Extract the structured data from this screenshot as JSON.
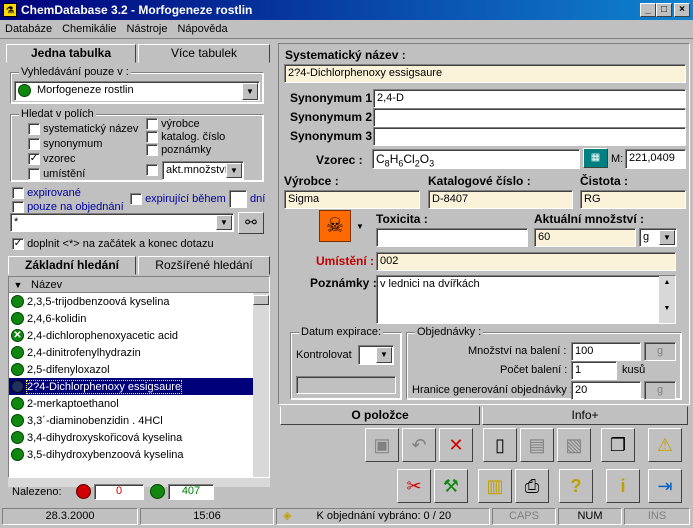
{
  "window": {
    "title": "ChemDatabase 3.2 - Morfogeneze rostlin",
    "btn_min": "_",
    "btn_max": "□",
    "btn_close": "×"
  },
  "menu": [
    "Databáze",
    "Chemikálie",
    "Nástroje",
    "Nápověda"
  ],
  "left": {
    "tabs": [
      "Jedna tabulka",
      "Více tabulek"
    ],
    "search_only_label": "Vyhledávání pouze v :",
    "search_only_value": "Morfogeneze rostlin",
    "fields_group": "Hledat v polích",
    "fields": [
      {
        "label": "systematický název",
        "checked": false
      },
      {
        "label": "synonymum",
        "checked": false
      },
      {
        "label": "vzorec",
        "checked": true
      },
      {
        "label": "umístění",
        "checked": false
      }
    ],
    "fields2": [
      {
        "label": "výrobce",
        "checked": false
      },
      {
        "label": "katalog. číslo",
        "checked": false
      },
      {
        "label": "poznámky",
        "checked": false
      }
    ],
    "quantity_combo": "akt.množství",
    "expired_label": "expirované",
    "order_only_label": "pouze na objednání",
    "expiring_label": "expirující během",
    "days_label": "dní",
    "search_value": "*",
    "wildcard_label": "doplnit <*> na začátek a konec dotazu",
    "search_tabs": [
      "Základní hledání",
      "Rozšířené hledání"
    ],
    "list_header": "Název",
    "items": [
      {
        "name": "2,3,5-trijodbenzoová kyselina",
        "mark": ""
      },
      {
        "name": "2,4,6-kolidin",
        "mark": ""
      },
      {
        "name": "2,4-dichlorophenoxyacetic acid",
        "mark": "x"
      },
      {
        "name": "2,4-dinitrofenylhydrazin",
        "mark": ""
      },
      {
        "name": "2,5-difenyloxazol",
        "mark": ""
      },
      {
        "name": "2?4-Dichlorphenoxy essigsaure",
        "mark": "sel"
      },
      {
        "name": "2-merkaptoethanol",
        "mark": ""
      },
      {
        "name": "3,3´-diaminobenzidin . 4HCl",
        "mark": ""
      },
      {
        "name": "3,4-dihydroxyskořicová kyselina",
        "mark": ""
      },
      {
        "name": "3,5-dihydroxybenzoová kyselina",
        "mark": ""
      }
    ],
    "found_label": "Nalezeno:",
    "found_red": "0",
    "found_green": "407"
  },
  "right": {
    "sys_name_label": "Systematický název :",
    "sys_name_value": "2?4-Dichlorphenoxy essigsaure",
    "syn1_label": "Synonymum 1:",
    "syn1_value": "2,4-D",
    "syn2_label": "Synonymum 2:",
    "syn2_value": "",
    "syn3_label": "Synonymum 3:",
    "syn3_value": "",
    "formula_label": "Vzorec :",
    "formula_value": "C8H6Cl2O3",
    "mw_label": "M:",
    "mw_value": "221,0409",
    "maker_label": "Výrobce :",
    "maker_value": "Sigma",
    "catalog_label": "Katalogové číslo :",
    "catalog_value": "D-8407",
    "purity_label": "Čistota :",
    "purity_value": "RG",
    "toxicity_label": "Toxicita :",
    "toxicity_value": "",
    "amount_label": "Aktuální množství :",
    "amount_value": "60",
    "amount_unit": "g",
    "location_label": "Umístění :",
    "location_value": "002",
    "notes_label": "Poznámky :",
    "notes_value": "v lednici na dvířkách",
    "expiry_group": "Datum expirace:",
    "check_label": "Kontrolovat",
    "orders_group": "Objednávky :",
    "pack_label": "Množství na balení :",
    "pack_value": "100",
    "pack_unit": "g",
    "count_label": "Počet balení :",
    "count_value": "1",
    "count_unit": "kusů",
    "limit_label": "Hranice generování objednávky :",
    "limit_value": "20",
    "limit_unit": "g",
    "tabs": [
      "O položce",
      "Info+"
    ]
  },
  "status": {
    "date": "28.3.2000",
    "time": "15:06",
    "order_text": "K objednání vybráno: 0 / 20",
    "caps": "CAPS",
    "num": "NUM",
    "ins": "INS"
  },
  "colors": {
    "title_start": "#00007b",
    "selection": "#00007b",
    "cream": "#fbf3d9",
    "green": "#108810",
    "red": "#d00000"
  }
}
